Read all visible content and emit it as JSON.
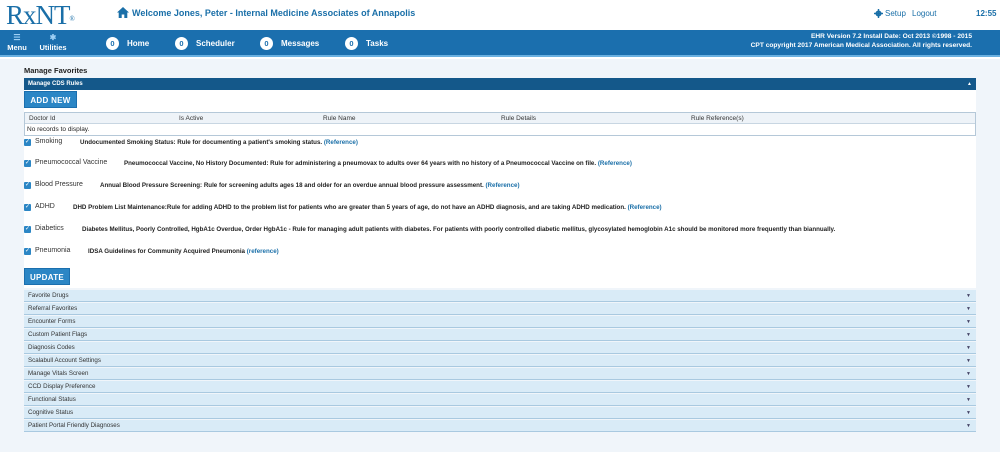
{
  "header": {
    "logo": "RxNT",
    "logo_mark": "®",
    "welcome": "Welcome Jones, Peter - Internal Medicine Associates of Annapolis",
    "setup": "Setup",
    "logout": "Logout",
    "time": "12:55"
  },
  "nav": {
    "menu": "Menu",
    "utilities": "Utilities",
    "tabs": [
      {
        "count": "0",
        "label": "Home"
      },
      {
        "count": "0",
        "label": "Scheduler"
      },
      {
        "count": "0",
        "label": "Messages"
      },
      {
        "count": "0",
        "label": "Tasks"
      }
    ],
    "version_line1": "EHR Version 7.2 Install Date: Oct 2013 ©1998 - 2015",
    "version_line2": "CPT copyright 2017 American Medical Association. All rights reserved."
  },
  "page": {
    "title": "Manage Favorites",
    "cds_header": "Manage CDS Rules",
    "add_new": "ADD NEW",
    "update": "UPDATE"
  },
  "grid": {
    "columns": [
      "Doctor Id",
      "Is Active",
      "Rule Name",
      "Rule Details",
      "Rule Reference(s)"
    ],
    "empty": "No records to display."
  },
  "rules": [
    {
      "name": "Smoking",
      "desc": "Undocumented Smoking Status: Rule for documenting a patient's smoking status.",
      "ref": "(Reference)"
    },
    {
      "name": "Pneumococcal Vaccine",
      "desc": "Pneumococcal Vaccine, No History Documented: Rule for administering a pneumovax to adults over 64 years with no history of a Pneumococcal Vaccine on file.",
      "ref": "(Reference)"
    },
    {
      "name": "Blood Pressure",
      "desc": "Annual Blood Pressure Screening: Rule for screening adults ages 18 and older for an overdue annual blood pressure assessment.",
      "ref": "(Reference)"
    },
    {
      "name": "ADHD",
      "desc": "DHD Problem List Maintenance:Rule for adding ADHD to the problem list for patients who are greater than 5 years of age, do not have an ADHD diagnosis, and are taking ADHD medication.",
      "ref": "(Reference)"
    },
    {
      "name": "Diabetics",
      "desc": "Diabetes Mellitus, Poorly Controlled, HgbA1c Overdue, Order HgbA1c - Rule for managing adult patients with diabetes. For patients with poorly controlled diabetic mellitus, glycosylated hemoglobin A1c should be monitored more frequently than biannually.",
      "ref": ""
    },
    {
      "name": "Pneumonia",
      "desc": "IDSA Guidelines for Community Acquired Pneumonia",
      "ref": "(reference)"
    }
  ],
  "sections": [
    "Favorite Drugs",
    "Referral Favorites",
    "Encounter Forms",
    "Custom Patient Flags",
    "Diagnosis Codes",
    "Scalabull Account Settings",
    "Manage Vitals Screen",
    "CCD Display Preference",
    "Functional Status",
    "Cognitive Status",
    "Patient Portal Friendly Diagnoses"
  ]
}
